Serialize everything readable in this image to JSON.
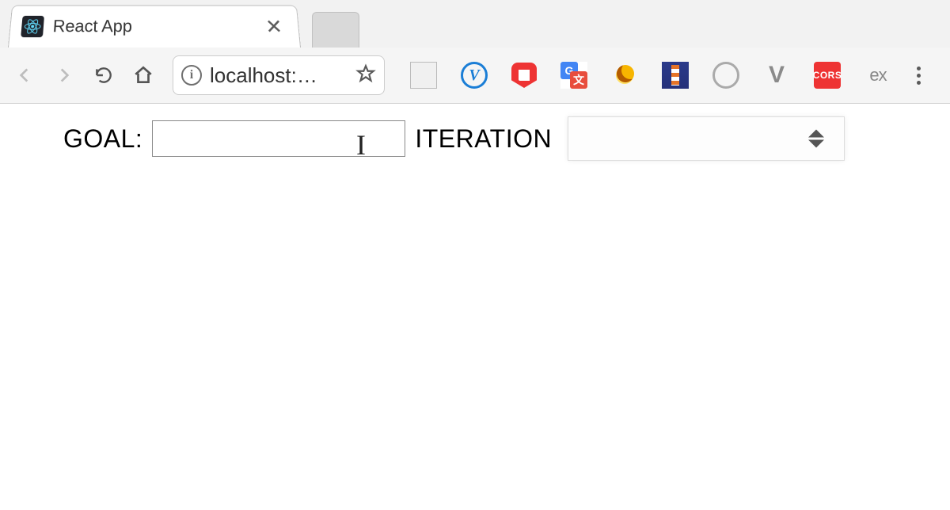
{
  "browser": {
    "tab_title": "React App",
    "url_display": "localhost:…",
    "extensions": [
      {
        "id": "reader",
        "name": "reader-view"
      },
      {
        "id": "vimium",
        "name": "vimium",
        "glyph": "V"
      },
      {
        "id": "ublock",
        "name": "ublock-origin"
      },
      {
        "id": "translate",
        "name": "google-translate"
      },
      {
        "id": "moon",
        "name": "dark-mode"
      },
      {
        "id": "lighthouse",
        "name": "lighthouse"
      },
      {
        "id": "circleo",
        "name": "circle-extension"
      },
      {
        "id": "vue",
        "name": "vue-devtools",
        "glyph": "V"
      },
      {
        "id": "cors",
        "name": "cors-toggle",
        "glyph": "CORS"
      },
      {
        "id": "ex",
        "name": "ex-extension",
        "glyph": "ex"
      }
    ]
  },
  "form": {
    "goal_label": "GOAL:",
    "goal_value": "",
    "iteration_label": "ITERATION",
    "iteration_value": ""
  }
}
